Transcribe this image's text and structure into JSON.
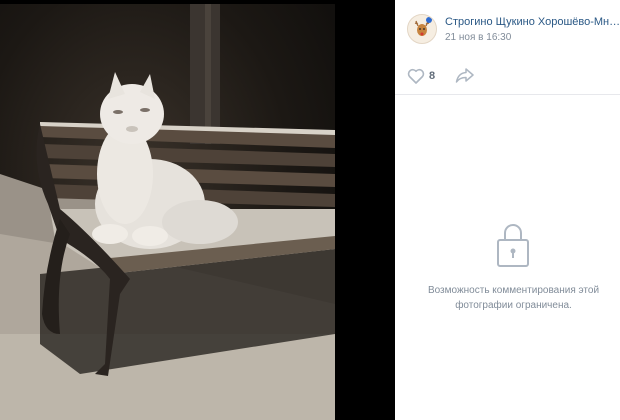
{
  "post": {
    "group_name": "Строгино Щукино Хорошёво-Мнёвники",
    "time": "21 ноя в 16:30"
  },
  "actions": {
    "like_icon": "heart-icon",
    "like_count": "8",
    "share_icon": "share-arrow-icon"
  },
  "comments": {
    "lock_icon": "lock-icon",
    "restricted_text": "Возможность комментирования этой фотографии ограничена."
  },
  "photo": {
    "subject": "snow-cat-sculpture-on-bench"
  },
  "colors": {
    "link": "#2a5885",
    "muted": "#818c99",
    "icon": "#aeb7c2"
  }
}
